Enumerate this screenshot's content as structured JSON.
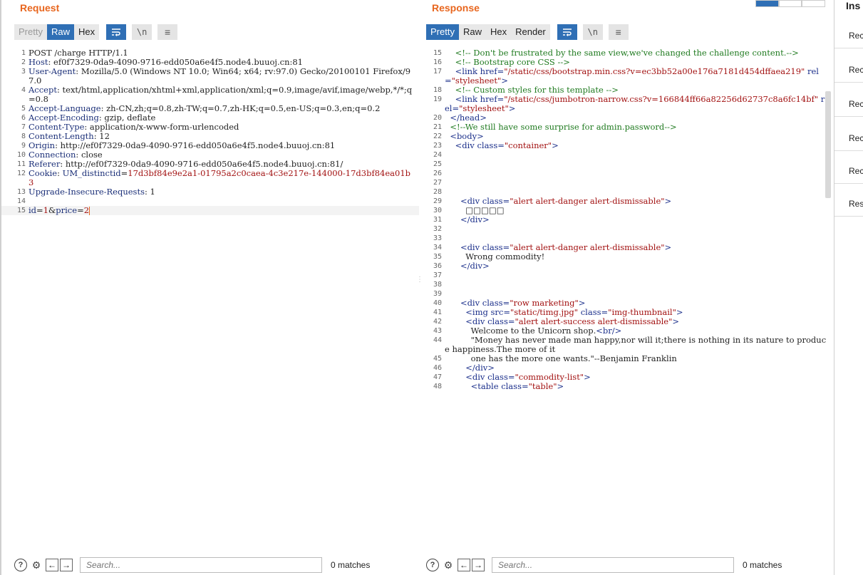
{
  "request": {
    "title": "Request",
    "tabs": [
      "Pretty",
      "Raw",
      "Hex"
    ],
    "active_tab": "Raw",
    "lines": [
      {
        "n": "1",
        "parts": [
          {
            "t": "POST /charge HTTP/1.1"
          }
        ]
      },
      {
        "n": "2",
        "parts": [
          {
            "t": "Host",
            "c": "hdr"
          },
          {
            "t": ": ef0f7329-0da9-4090-9716-edd050a6e4f5.node4.buuoj.cn:81"
          }
        ]
      },
      {
        "n": "3",
        "parts": [
          {
            "t": "User-Agent",
            "c": "hdr"
          },
          {
            "t": ": Mozilla/5.0 (Windows NT 10.0; Win64; x64; rv:97.0) Gecko/20100101 Firefox/97.0"
          }
        ]
      },
      {
        "n": "4",
        "parts": [
          {
            "t": "Accept",
            "c": "hdr"
          },
          {
            "t": ": text/html,application/xhtml+xml,application/xml;q=0.9,image/avif,image/webp,*/*;q=0.8"
          }
        ]
      },
      {
        "n": "5",
        "parts": [
          {
            "t": "Accept-Language",
            "c": "hdr"
          },
          {
            "t": ": zh-CN,zh;q=0.8,zh-TW;q=0.7,zh-HK;q=0.5,en-US;q=0.3,en;q=0.2"
          }
        ]
      },
      {
        "n": "6",
        "parts": [
          {
            "t": "Accept-Encoding",
            "c": "hdr"
          },
          {
            "t": ": gzip, deflate"
          }
        ]
      },
      {
        "n": "7",
        "parts": [
          {
            "t": "Content-Type",
            "c": "hdr"
          },
          {
            "t": ": application/x-www-form-urlencoded"
          }
        ]
      },
      {
        "n": "8",
        "parts": [
          {
            "t": "Content-Length",
            "c": "hdr"
          },
          {
            "t": ": 12"
          }
        ]
      },
      {
        "n": "9",
        "parts": [
          {
            "t": "Origin",
            "c": "hdr"
          },
          {
            "t": ": http://ef0f7329-0da9-4090-9716-edd050a6e4f5.node4.buuoj.cn:81"
          }
        ]
      },
      {
        "n": "10",
        "parts": [
          {
            "t": "Connection",
            "c": "hdr"
          },
          {
            "t": ": close"
          }
        ]
      },
      {
        "n": "11",
        "parts": [
          {
            "t": "Referer",
            "c": "hdr"
          },
          {
            "t": ": http://ef0f7329-0da9-4090-9716-edd050a6e4f5.node4.buuoj.cn:81/"
          }
        ]
      },
      {
        "n": "12",
        "parts": [
          {
            "t": "Cookie",
            "c": "hdr"
          },
          {
            "t": ": "
          },
          {
            "t": "UM_distinctid",
            "c": "hdr"
          },
          {
            "t": "="
          },
          {
            "t": "17d3bf84e9e2a1-01795a2c0caea-4c3e217e-144000-17d3bf84ea01b3",
            "c": "val-red"
          }
        ]
      },
      {
        "n": "13",
        "parts": [
          {
            "t": "Upgrade-Insecure-Requests",
            "c": "hdr"
          },
          {
            "t": ": 1"
          }
        ]
      },
      {
        "n": "14",
        "parts": [
          {
            "t": ""
          }
        ]
      },
      {
        "n": "15",
        "parts": [
          {
            "t": "id",
            "c": "hdr"
          },
          {
            "t": "="
          },
          {
            "t": "1",
            "c": "val-red"
          },
          {
            "t": "&"
          },
          {
            "t": "price",
            "c": "hdr"
          },
          {
            "t": "="
          },
          {
            "t": "2",
            "c": "val-red"
          }
        ],
        "hl": true,
        "cursor": true
      }
    ],
    "search_placeholder": "Search...",
    "matches": "0 matches"
  },
  "response": {
    "title": "Response",
    "tabs": [
      "Pretty",
      "Raw",
      "Hex",
      "Render"
    ],
    "active_tab": "Pretty",
    "lines": [
      {
        "n": "15",
        "parts": [
          {
            "t": "    <!-- Don't be frustrated by the same view,we've changed the challenge content.-->",
            "c": "cmt"
          }
        ]
      },
      {
        "n": "16",
        "parts": [
          {
            "t": "    <!-- Bootstrap core CSS -->",
            "c": "cmt"
          }
        ]
      },
      {
        "n": "17",
        "parts": [
          {
            "t": "    <link ",
            "c": "tag"
          },
          {
            "t": "href=",
            "c": "attr"
          },
          {
            "t": "\"/static/css/bootstrap.min.css?v=ec3bb52a00e176a7181d454dffaea219\"",
            "c": "str"
          },
          {
            "t": " rel=",
            "c": "attr"
          },
          {
            "t": "\"stylesheet\"",
            "c": "str"
          },
          {
            "t": ">",
            "c": "tag"
          }
        ]
      },
      {
        "n": "18",
        "parts": [
          {
            "t": "    <!-- Custom styles for this template -->",
            "c": "cmt"
          }
        ]
      },
      {
        "n": "19",
        "parts": [
          {
            "t": "    <link ",
            "c": "tag"
          },
          {
            "t": "href=",
            "c": "attr"
          },
          {
            "t": "\"/static/css/jumbotron-narrow.css?v=166844ff66a82256d62737c8a6fc14bf\"",
            "c": "str"
          },
          {
            "t": " rel=",
            "c": "attr"
          },
          {
            "t": "\"stylesheet\"",
            "c": "str"
          },
          {
            "t": ">",
            "c": "tag"
          }
        ]
      },
      {
        "n": "20",
        "parts": [
          {
            "t": "  </head>",
            "c": "tag"
          }
        ]
      },
      {
        "n": "21",
        "parts": [
          {
            "t": "  <!--We still have some surprise for admin.password-->",
            "c": "cmt"
          }
        ]
      },
      {
        "n": "22",
        "parts": [
          {
            "t": "  <body>",
            "c": "tag"
          }
        ]
      },
      {
        "n": "23",
        "parts": [
          {
            "t": "    <div ",
            "c": "tag"
          },
          {
            "t": "class=",
            "c": "attr"
          },
          {
            "t": "\"container\"",
            "c": "str"
          },
          {
            "t": ">",
            "c": "tag"
          }
        ]
      },
      {
        "n": "24",
        "parts": [
          {
            "t": ""
          }
        ]
      },
      {
        "n": "25",
        "parts": [
          {
            "t": ""
          }
        ]
      },
      {
        "n": "26",
        "parts": [
          {
            "t": ""
          }
        ]
      },
      {
        "n": "27",
        "parts": [
          {
            "t": ""
          }
        ]
      },
      {
        "n": "28",
        "parts": [
          {
            "t": ""
          }
        ]
      },
      {
        "n": "29",
        "parts": [
          {
            "t": "      <div ",
            "c": "tag"
          },
          {
            "t": "class=",
            "c": "attr"
          },
          {
            "t": "\"alert alert-danger alert-dismissable\"",
            "c": "str"
          },
          {
            "t": ">",
            "c": "tag"
          }
        ]
      },
      {
        "n": "30",
        "parts": [
          {
            "t": "        □□□□□"
          }
        ]
      },
      {
        "n": "31",
        "parts": [
          {
            "t": "      </div>",
            "c": "tag"
          }
        ]
      },
      {
        "n": "32",
        "parts": [
          {
            "t": ""
          }
        ]
      },
      {
        "n": "33",
        "parts": [
          {
            "t": ""
          }
        ]
      },
      {
        "n": "34",
        "parts": [
          {
            "t": "      <div ",
            "c": "tag"
          },
          {
            "t": "class=",
            "c": "attr"
          },
          {
            "t": "\"alert alert-danger alert-dismissable\"",
            "c": "str"
          },
          {
            "t": ">",
            "c": "tag"
          }
        ]
      },
      {
        "n": "35",
        "parts": [
          {
            "t": "        Wrong commodity!"
          }
        ]
      },
      {
        "n": "36",
        "parts": [
          {
            "t": "      </div>",
            "c": "tag"
          }
        ]
      },
      {
        "n": "37",
        "parts": [
          {
            "t": ""
          }
        ]
      },
      {
        "n": "38",
        "parts": [
          {
            "t": ""
          }
        ]
      },
      {
        "n": "39",
        "parts": [
          {
            "t": ""
          }
        ]
      },
      {
        "n": "40",
        "parts": [
          {
            "t": "      <div ",
            "c": "tag"
          },
          {
            "t": "class=",
            "c": "attr"
          },
          {
            "t": "\"row marketing\"",
            "c": "str"
          },
          {
            "t": ">",
            "c": "tag"
          }
        ]
      },
      {
        "n": "41",
        "parts": [
          {
            "t": "        <img ",
            "c": "tag"
          },
          {
            "t": "src=",
            "c": "attr"
          },
          {
            "t": "\"static/timg.jpg\"",
            "c": "str"
          },
          {
            "t": " class=",
            "c": "attr"
          },
          {
            "t": "\"img-thumbnail\"",
            "c": "str"
          },
          {
            "t": ">",
            "c": "tag"
          }
        ]
      },
      {
        "n": "42",
        "parts": [
          {
            "t": "        <div ",
            "c": "tag"
          },
          {
            "t": "class=",
            "c": "attr"
          },
          {
            "t": "\"alert alert-success alert-dismissable\"",
            "c": "str"
          },
          {
            "t": ">",
            "c": "tag"
          }
        ]
      },
      {
        "n": "43",
        "parts": [
          {
            "t": "          Welcome to the Unicorn shop."
          },
          {
            "t": "<br/>",
            "c": "tag"
          }
        ]
      },
      {
        "n": "44",
        "parts": [
          {
            "t": "          \"Money has never made man happy,nor will it;there is nothing in its nature to produce happiness.The more of it"
          }
        ]
      },
      {
        "n": "45",
        "parts": [
          {
            "t": "          one has the more one wants.\"--Benjamin Franklin"
          }
        ]
      },
      {
        "n": "46",
        "parts": [
          {
            "t": "        </div>",
            "c": "tag"
          }
        ]
      },
      {
        "n": "47",
        "parts": [
          {
            "t": "        <div ",
            "c": "tag"
          },
          {
            "t": "class=",
            "c": "attr"
          },
          {
            "t": "\"commodity-list\"",
            "c": "str"
          },
          {
            "t": ">",
            "c": "tag"
          }
        ]
      },
      {
        "n": "48",
        "parts": [
          {
            "t": "          <table ",
            "c": "tag"
          },
          {
            "t": "class=",
            "c": "attr"
          },
          {
            "t": "\"table\"",
            "c": "str"
          },
          {
            "t": ">",
            "c": "tag"
          }
        ]
      }
    ],
    "search_placeholder": "Search...",
    "matches": "0 matches"
  },
  "inspector": {
    "title": "Ins",
    "items": [
      "Rec",
      "Rec",
      "Rec",
      "Rec",
      "Rec",
      "Res"
    ]
  },
  "icons": {
    "wrap": "wrap-icon",
    "newline": "\\n",
    "menu": "≡",
    "help": "?",
    "settings": "⚙",
    "back": "←",
    "forward": "→"
  }
}
